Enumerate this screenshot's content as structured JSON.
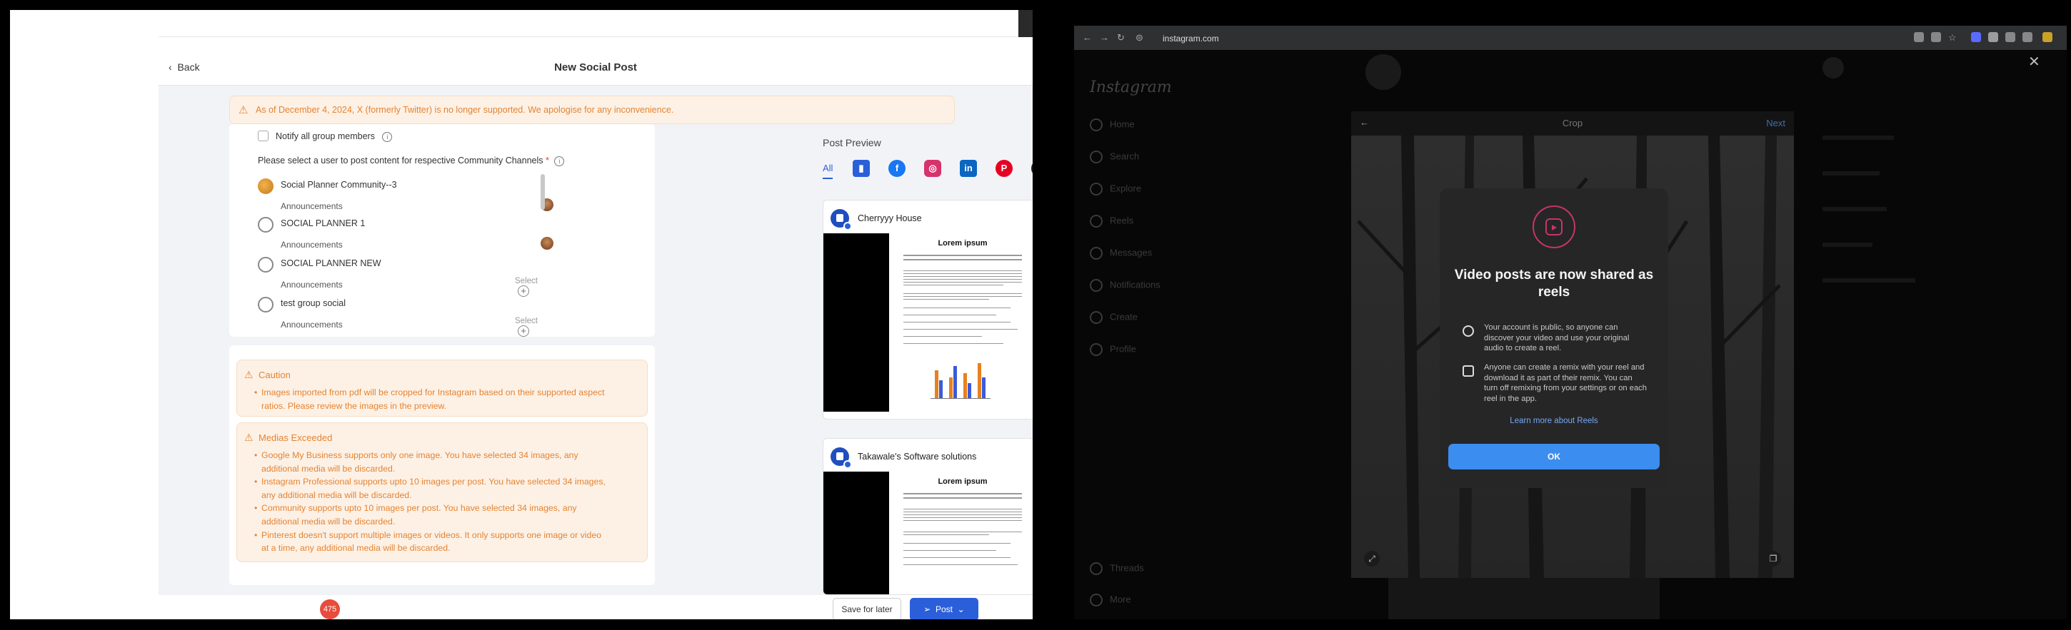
{
  "left_window": {
    "back_label": "Back",
    "title": "New Social Post",
    "warning": "As of December 4, 2024, X (formerly Twitter) is no longer supported. We apologise for any inconvenience.",
    "notify_label": "Notify all group members",
    "select_prompt": "Please select a user to post content for respective Community Channels",
    "required_mark": "*",
    "channels": [
      {
        "name": "Social Planner Community--3",
        "sub": "Announcements",
        "select": ""
      },
      {
        "name": "SOCIAL PLANNER 1",
        "sub": "Announcements",
        "select": ""
      },
      {
        "name": "SOCIAL PLANNER NEW",
        "sub": "Announcements",
        "select": "Select"
      },
      {
        "name": "test group social",
        "sub": "Announcements",
        "select": "Select"
      }
    ],
    "caution": {
      "title": "Caution",
      "items": [
        "Images imported from pdf will be cropped for Instagram based on their supported aspect",
        "ratios. Please review the images in the preview."
      ]
    },
    "medias_exceeded": {
      "title": "Medias Exceeded",
      "items": [
        [
          "Google My Business supports only one image. You have selected 34 images, any",
          "additional media will be discarded."
        ],
        [
          "Instagram Professional supports upto 10 images per post. You have selected 34 images,",
          "any additional media will be discarded."
        ],
        [
          "Community supports upto 10 images per post. You have selected 34 images, any",
          "additional media will be discarded."
        ],
        [
          "Pinterest doesn't support multiple images or videos. It only supports one image or video",
          "at a time, any additional media will be discarded."
        ]
      ]
    },
    "post_preview": {
      "title": "Post Preview",
      "all_tab": "All",
      "cards": [
        {
          "name": "Cherryyy House",
          "doc_title": "Lorem ipsum"
        },
        {
          "name": "Takawale's Software solutions",
          "doc_title": "Lorem ipsum"
        }
      ]
    },
    "save_label": "Save for later",
    "post_label": "Post",
    "notif_count": "475"
  },
  "right_window": {
    "url": "instagram.com",
    "nav_items": [
      "Home",
      "Search",
      "Explore",
      "Reels",
      "Messages",
      "Notifications",
      "Create",
      "Profile"
    ],
    "bottom_nav": [
      "Threads",
      "More"
    ],
    "crop_label": "Crop",
    "next_label": "Next",
    "modal": {
      "title": "Video posts are now shared as reels",
      "item1": "Your account is public, so anyone can discover your video and use your original audio to create a reel.",
      "item2": "Anyone can create a remix with your reel and download it as part of their remix. You can turn off remixing from your settings or on each reel in the app.",
      "link": "Learn more about Reels",
      "ok": "OK"
    }
  }
}
